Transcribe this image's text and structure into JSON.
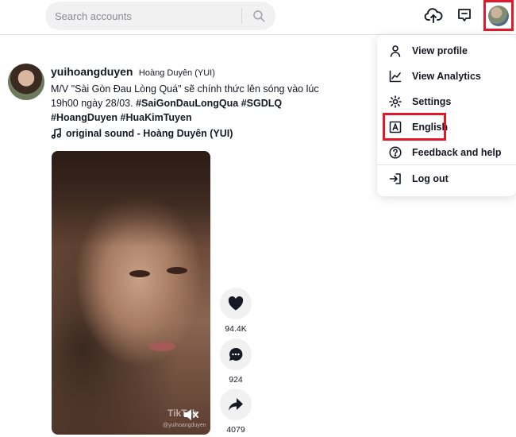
{
  "header": {
    "search_placeholder": "Search accounts",
    "icons": [
      "search-icon",
      "upload-icon",
      "inbox-icon",
      "avatar"
    ]
  },
  "post": {
    "author_id": "yuihoangduyen",
    "author_nickname": "Hoàng Duyên (YUI)",
    "caption_text": "M/V \"Sài Gòn Đau Lòng Quá\" sẽ chính thức lên sóng vào lúc 19h00 ngày 28/03.",
    "hashtags": [
      "#SaiGonDauLongQua",
      "#SGDLQ",
      "#HoangDuyen",
      "#HuaKimTuyen"
    ],
    "sound": "original sound - Hoàng Duyên (YUI)",
    "watermark": "TikTok",
    "watermark_handle": "@yuihoangduyen",
    "likes": "94.4K",
    "comments": "924",
    "shares": "4079"
  },
  "menu": {
    "items": [
      {
        "label": "View profile",
        "icon": "person-icon"
      },
      {
        "label": "View Analytics",
        "icon": "analytics-icon"
      },
      {
        "label": "Settings",
        "icon": "gear-icon"
      },
      {
        "label": "English",
        "icon": "language-icon"
      },
      {
        "label": "Feedback and help",
        "icon": "help-icon"
      },
      {
        "label": "Log out",
        "icon": "logout-icon"
      }
    ]
  },
  "colors": {
    "highlight": "#e0192b",
    "text": "#161823",
    "search_bg": "#f1f1f2"
  }
}
